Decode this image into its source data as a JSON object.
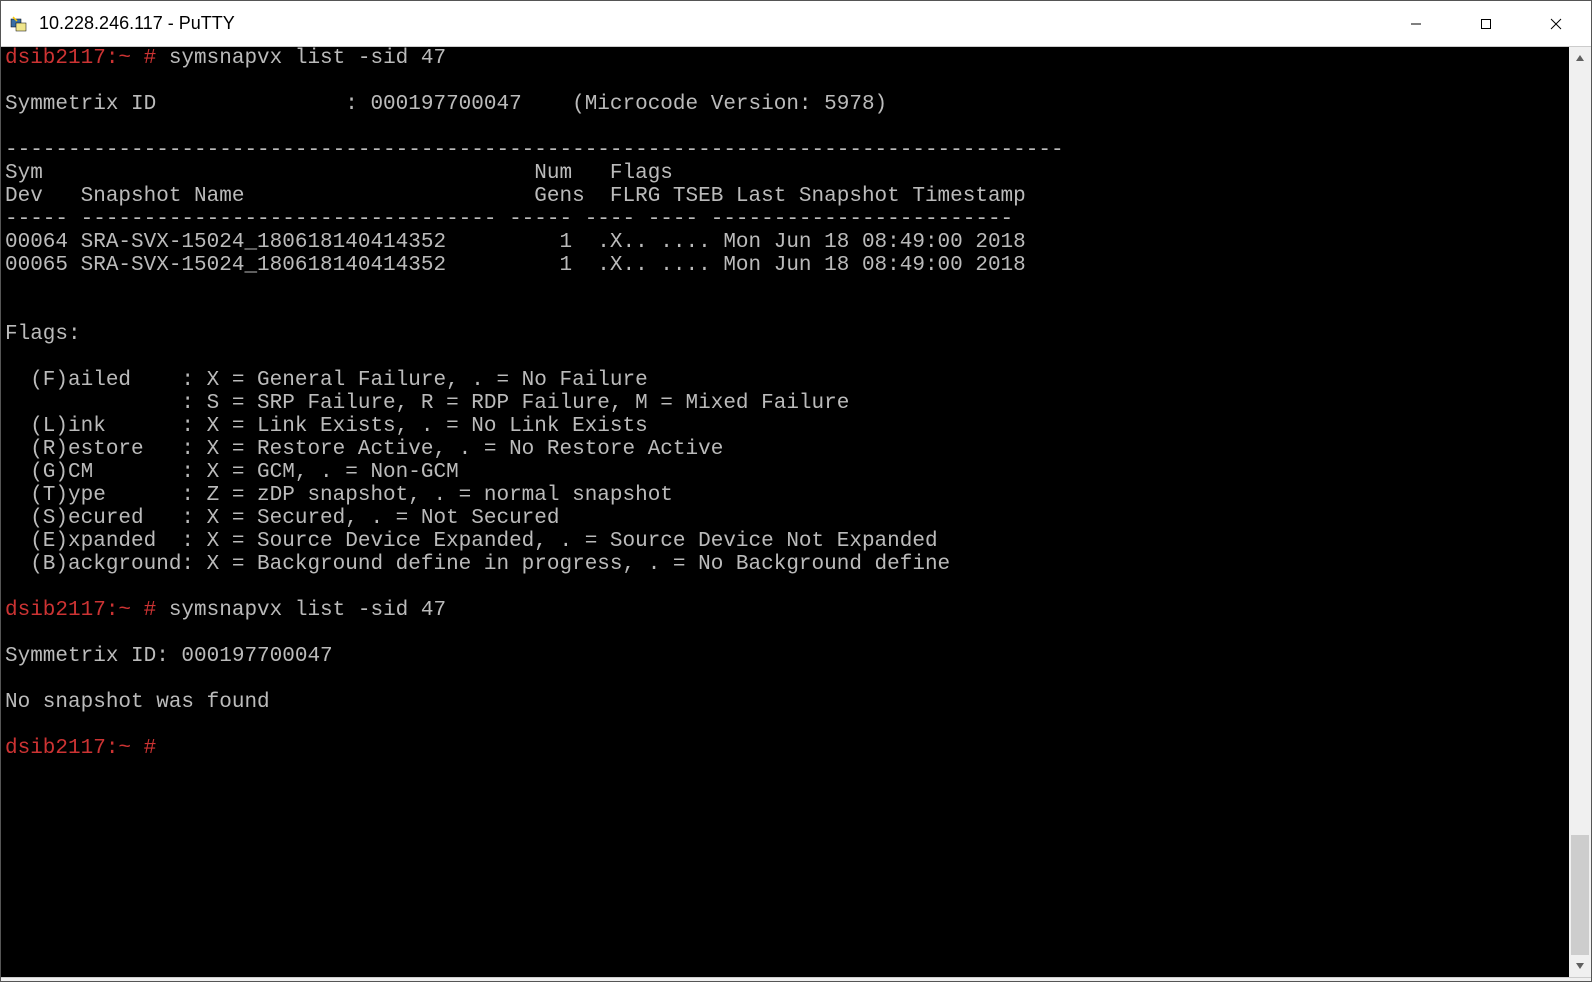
{
  "window": {
    "title": "10.228.246.117 - PuTTY"
  },
  "session": {
    "prompt1": "dsib2117:~ # ",
    "cmd1": "symsnapvx list -sid 47",
    "blank1": "",
    "symid_line": "Symmetrix ID               : 000197700047    (Microcode Version: 5978)",
    "blank2": "",
    "sep_top": "------------------------------------------------------------------------------------",
    "hdr1": "Sym                                       Num   Flags",
    "hdr2": "Dev   Snapshot Name                       Gens  FLRG TSEB Last Snapshot Timestamp",
    "sep_mid": "----- --------------------------------- ----- ---- ---- ------------------------",
    "row1": "00064 SRA-SVX-15024_180618140414352         1  .X.. .... Mon Jun 18 08:49:00 2018",
    "row2": "00065 SRA-SVX-15024_180618140414352         1  .X.. .... Mon Jun 18 08:49:00 2018",
    "blank3": "",
    "blank4": "",
    "flags_hdr": "Flags:",
    "blank5": "",
    "flag_f": "  (F)ailed    : X = General Failure, . = No Failure",
    "flag_f2": "              : S = SRP Failure, R = RDP Failure, M = Mixed Failure",
    "flag_l": "  (L)ink      : X = Link Exists, . = No Link Exists",
    "flag_r": "  (R)estore   : X = Restore Active, . = No Restore Active",
    "flag_g": "  (G)CM       : X = GCM, . = Non-GCM",
    "flag_t": "  (T)ype      : Z = zDP snapshot, . = normal snapshot",
    "flag_s": "  (S)ecured   : X = Secured, . = Not Secured",
    "flag_e": "  (E)xpanded  : X = Source Device Expanded, . = Source Device Not Expanded",
    "flag_b": "  (B)ackground: X = Background define in progress, . = No Background define",
    "blank6": "",
    "prompt2": "dsib2117:~ # ",
    "cmd2": "symsnapvx list -sid 47",
    "blank7": "",
    "symid_line2": "Symmetrix ID: 000197700047",
    "blank8": "",
    "nosnap": "No snapshot was found",
    "blank9": "",
    "prompt3": "dsib2117:~ # "
  }
}
